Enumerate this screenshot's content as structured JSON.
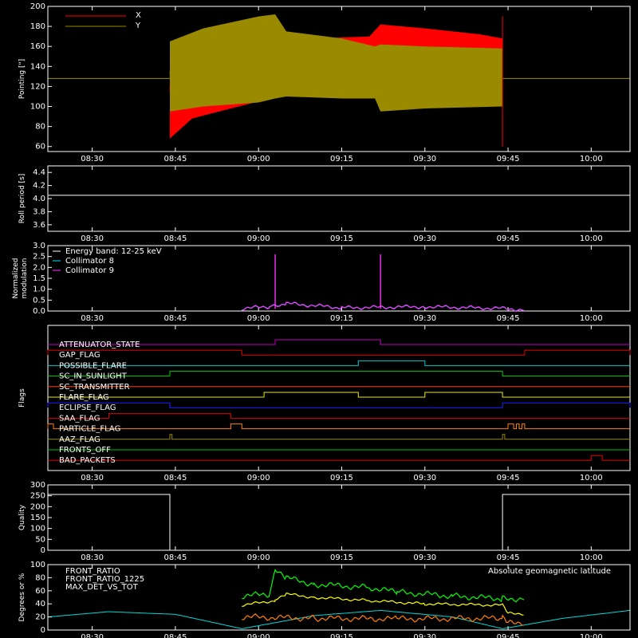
{
  "time_ticks": [
    "08:30",
    "08:45",
    "09:00",
    "09:15",
    "09:30",
    "09:45",
    "10:00"
  ],
  "time_range": [
    "08:22",
    "10:07"
  ],
  "panels": {
    "pointing": {
      "ylabel": "Pointing [\"]",
      "yticks": [
        60,
        80,
        100,
        120,
        140,
        160,
        180,
        200
      ],
      "ylim": [
        55,
        200
      ],
      "legend": [
        {
          "name": "X",
          "color": "#ff0000"
        },
        {
          "name": "Y",
          "color": "#9a8a00"
        }
      ],
      "baseline_value": 128,
      "active_start": "08:44",
      "active_end": "09:44",
      "x_series": [
        {
          "t": "08:44",
          "low": 68,
          "high": 150
        },
        {
          "t": "08:48",
          "low": 88,
          "high": 152
        },
        {
          "t": "08:55",
          "low": 98,
          "high": 158
        },
        {
          "t": "09:00",
          "low": 105,
          "high": 163
        },
        {
          "t": "09:04",
          "low": 112,
          "high": 170
        },
        {
          "t": "09:10",
          "low": 118,
          "high": 168
        },
        {
          "t": "09:20",
          "low": 122,
          "high": 170
        },
        {
          "t": "09:22",
          "low": 125,
          "high": 182
        },
        {
          "t": "09:30",
          "low": 125,
          "high": 178
        },
        {
          "t": "09:40",
          "low": 120,
          "high": 172
        },
        {
          "t": "09:44",
          "low": 118,
          "high": 168
        }
      ],
      "y_series": [
        {
          "t": "08:44",
          "low": 95,
          "high": 165
        },
        {
          "t": "08:50",
          "low": 100,
          "high": 178
        },
        {
          "t": "09:00",
          "low": 104,
          "high": 190
        },
        {
          "t": "09:03",
          "low": 108,
          "high": 192
        },
        {
          "t": "09:05",
          "low": 110,
          "high": 175
        },
        {
          "t": "09:15",
          "low": 108,
          "high": 168
        },
        {
          "t": "09:21",
          "low": 108,
          "high": 160
        },
        {
          "t": "09:22",
          "low": 95,
          "high": 162
        },
        {
          "t": "09:30",
          "low": 98,
          "high": 160
        },
        {
          "t": "09:44",
          "low": 100,
          "high": 158
        }
      ]
    },
    "roll": {
      "ylabel": "Roll period [s]",
      "yticks": [
        "3.6",
        "3.8",
        "4.0",
        "4.2",
        "4.4"
      ],
      "ylim": [
        3.5,
        4.5
      ],
      "value": 4.05
    },
    "modulation": {
      "ylabel": "Normalized modulation",
      "ylabel_lines": [
        "Normalized",
        "modulation"
      ],
      "yticks": [
        "0.0",
        "0.5",
        "1.0",
        "1.5",
        "2.0",
        "2.5",
        "3.0"
      ],
      "ylim": [
        0,
        3.0
      ],
      "legend": [
        {
          "name": "Energy band: 12-25 keV",
          "color": "#ffffff"
        },
        {
          "name": "Collimator 8",
          "color": "#00e0ff"
        },
        {
          "name": "Collimator 9",
          "color": "#ff30ff"
        }
      ],
      "spikes": [
        {
          "t": "09:03",
          "value": 2.6
        },
        {
          "t": "09:22",
          "value": 2.6
        }
      ]
    },
    "flags": {
      "ylabel": "Flags",
      "items": [
        {
          "name": "ATTENUATOR_STATE",
          "color": "#c000c0",
          "segments": [
            [
              "09:03",
              "09:22"
            ]
          ]
        },
        {
          "name": "GAP_FLAG",
          "color": "#e00000",
          "segments": [
            [
              "08:22",
              "08:57"
            ],
            [
              "09:48",
              "10:07"
            ]
          ]
        },
        {
          "name": "POSSIBLE_FLARE",
          "color": "#00c8c8",
          "segments": [
            [
              "09:18",
              "09:30"
            ]
          ]
        },
        {
          "name": "SC_IN_SUNLIGHT",
          "color": "#00d000",
          "segments": [
            [
              "08:44",
              "09:44"
            ]
          ]
        },
        {
          "name": "SC_TRANSMITTER",
          "color": "#ff4000",
          "segments": []
        },
        {
          "name": "FLARE_FLAG",
          "color": "#e8e800",
          "segments": [
            [
              "09:01",
              "09:18"
            ],
            [
              "09:30",
              "09:44"
            ]
          ]
        },
        {
          "name": "ECLIPSE_FLAG",
          "color": "#2020ff",
          "segments": [
            [
              "08:22",
              "08:44"
            ],
            [
              "09:44",
              "10:07"
            ]
          ]
        },
        {
          "name": "SAA_FLAG",
          "color": "#e00000",
          "segments": [
            [
              "08:33",
              "08:55"
            ]
          ]
        },
        {
          "name": "PARTICLE_FLAG",
          "color": "#ff8000",
          "segments": [
            [
              "08:22",
              "08:23"
            ],
            [
              "08:55",
              "08:57"
            ],
            [
              "09:45",
              "09:46"
            ],
            [
              "09:46.5",
              "09:47"
            ],
            [
              "09:47.5",
              "09:48"
            ]
          ]
        },
        {
          "name": "AAZ_FLAG",
          "color": "#9a8a00",
          "segments": [
            [
              "08:44",
              "08:44.4"
            ],
            [
              "09:44",
              "09:44.4"
            ]
          ]
        },
        {
          "name": "FRONTS_OFF",
          "color": "#00c000",
          "segments": []
        },
        {
          "name": "BAD_PACKETS",
          "color": "#e00000",
          "segments": [
            [
              "10:00",
              "10:02"
            ]
          ]
        }
      ]
    },
    "quality": {
      "ylabel": "Quality",
      "yticks": [
        0,
        50,
        100,
        150,
        200,
        250,
        300
      ],
      "ylim": [
        0,
        300
      ],
      "segments": [
        {
          "t0": "08:22",
          "t1": "08:44",
          "value": 256
        },
        {
          "t0": "08:44",
          "t1": "09:44",
          "value": 0
        },
        {
          "t0": "09:44",
          "t1": "10:07",
          "value": 256
        }
      ]
    },
    "ratio": {
      "ylabel": "Degrees or %",
      "yticks": [
        0,
        20,
        40,
        60,
        80,
        100
      ],
      "ylim": [
        0,
        100
      ],
      "legend_left": [
        {
          "name": "FRONT_RATIO",
          "color": "#ffff00"
        },
        {
          "name": "FRONT_RATIO_1225",
          "color": "#00ff00"
        },
        {
          "name": "MAX_DET_VS_TOT",
          "color": "#ff8000"
        }
      ],
      "legend_right": {
        "name": "Absolute geomagnetic latitude",
        "color": "#00d8d8"
      },
      "front_ratio_1225": [
        {
          "t": "08:57",
          "v": 52
        },
        {
          "t": "09:02",
          "v": 55
        },
        {
          "t": "09:03",
          "v": 90
        },
        {
          "t": "09:05",
          "v": 80
        },
        {
          "t": "09:10",
          "v": 70
        },
        {
          "t": "09:20",
          "v": 65
        },
        {
          "t": "09:25",
          "v": 58
        },
        {
          "t": "09:35",
          "v": 52
        },
        {
          "t": "09:44",
          "v": 48
        },
        {
          "t": "09:48",
          "v": 48
        }
      ],
      "front_ratio": [
        {
          "t": "08:57",
          "v": 38
        },
        {
          "t": "09:03",
          "v": 45
        },
        {
          "t": "09:05",
          "v": 55
        },
        {
          "t": "09:10",
          "v": 50
        },
        {
          "t": "09:20",
          "v": 45
        },
        {
          "t": "09:30",
          "v": 40
        },
        {
          "t": "09:44",
          "v": 38
        },
        {
          "t": "09:45",
          "v": 25
        },
        {
          "t": "09:48",
          "v": 25
        }
      ],
      "max_det_vs_tot": [
        {
          "t": "08:57",
          "v": 20
        },
        {
          "t": "09:10",
          "v": 18
        },
        {
          "t": "09:25",
          "v": 17
        },
        {
          "t": "09:44",
          "v": 18
        },
        {
          "t": "09:45",
          "v": 10
        },
        {
          "t": "09:48",
          "v": 12
        }
      ],
      "latitude": [
        {
          "t": "08:22",
          "v": 20
        },
        {
          "t": "08:33",
          "v": 28
        },
        {
          "t": "08:45",
          "v": 24
        },
        {
          "t": "08:57",
          "v": 2
        },
        {
          "t": "09:10",
          "v": 22
        },
        {
          "t": "09:22",
          "v": 30
        },
        {
          "t": "09:35",
          "v": 20
        },
        {
          "t": "09:44",
          "v": 2
        },
        {
          "t": "09:55",
          "v": 18
        },
        {
          "t": "10:07",
          "v": 30
        }
      ]
    }
  }
}
